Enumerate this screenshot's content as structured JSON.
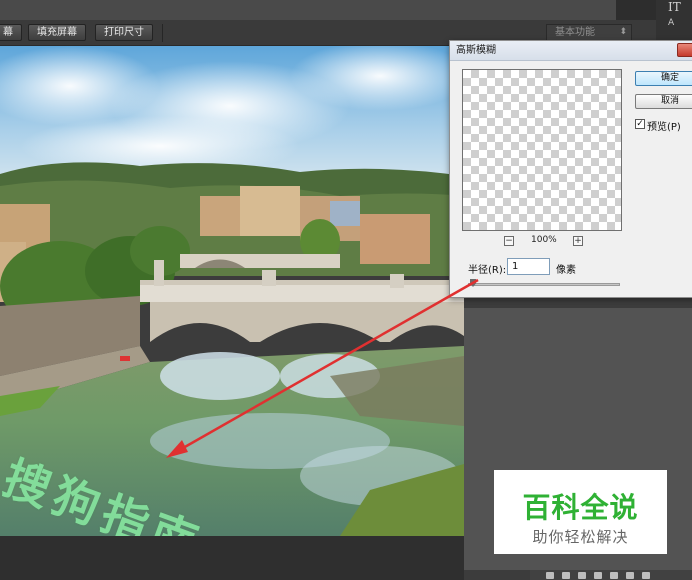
{
  "toolbar": {
    "fit_screen_partial": "幕",
    "fill_screen": "填充屏幕",
    "print_size": "打印尺寸",
    "workspace": "基本功能"
  },
  "dialog": {
    "title": "高斯模糊",
    "ok": "确定",
    "cancel": "取消",
    "preview_checkbox": "预览(P)",
    "preview_checked": true,
    "zoom": "100%",
    "zoom_out": "−",
    "zoom_in": "+",
    "radius_label": "半径(R):",
    "radius_value": "1",
    "radius_unit": "像素"
  },
  "canvas": {
    "watermark_text": "搜狗指南"
  },
  "side_tools": {
    "text_tool": "IT",
    "char_tool": "A"
  },
  "brand_card": {
    "title": "百科全说",
    "subtitle": "助你轻松解决"
  },
  "colors": {
    "arrow": "#e03030",
    "brand_green": "#2fb134"
  }
}
